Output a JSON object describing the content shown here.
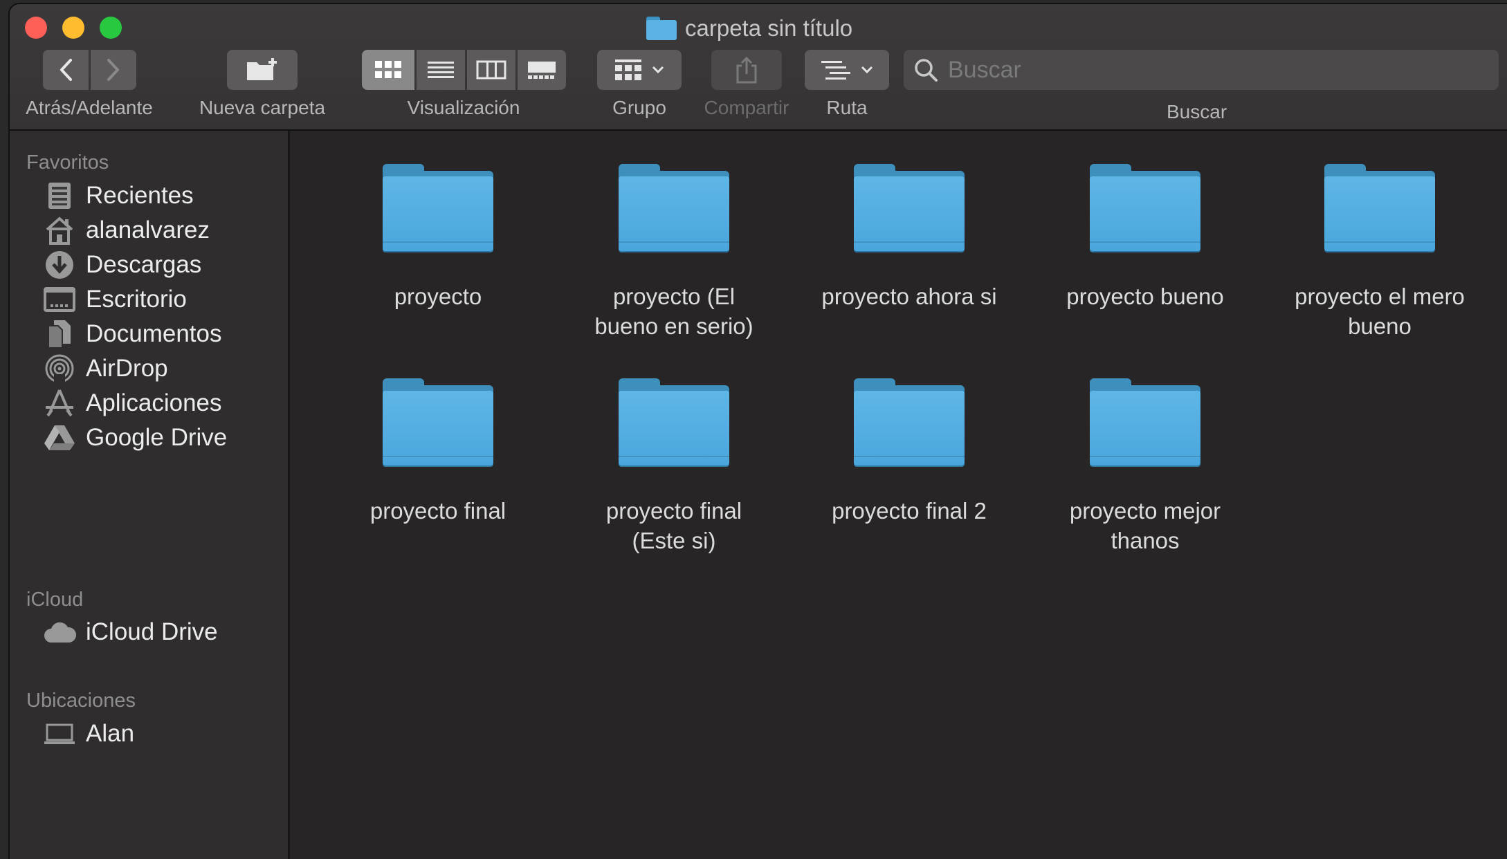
{
  "window": {
    "title": "carpeta sin título"
  },
  "toolbar": {
    "nav_label": "Atrás/Adelante",
    "new_folder_label": "Nueva carpeta",
    "view_label": "Visualización",
    "group_label": "Grupo",
    "share_label": "Compartir",
    "path_label": "Ruta",
    "search_label": "Buscar",
    "search_placeholder": "Buscar",
    "search_value": ""
  },
  "sidebar": {
    "favorites_title": "Favoritos",
    "favorites": [
      {
        "label": "Recientes",
        "icon": "recents-icon"
      },
      {
        "label": "alanalvarez",
        "icon": "home-icon"
      },
      {
        "label": "Descargas",
        "icon": "downloads-icon"
      },
      {
        "label": "Escritorio",
        "icon": "desktop-icon"
      },
      {
        "label": "Documentos",
        "icon": "documents-icon"
      },
      {
        "label": "AirDrop",
        "icon": "airdrop-icon"
      },
      {
        "label": "Aplicaciones",
        "icon": "applications-icon"
      },
      {
        "label": "Google Drive",
        "icon": "google-drive-icon"
      }
    ],
    "icloud_title": "iCloud",
    "icloud": [
      {
        "label": "iCloud Drive",
        "icon": "cloud-icon"
      }
    ],
    "locations_title": "Ubicaciones",
    "locations": [
      {
        "label": "Alan",
        "icon": "laptop-icon"
      }
    ]
  },
  "files": [
    {
      "name": "proyecto"
    },
    {
      "name": "proyecto (El bueno en serio)"
    },
    {
      "name": "proyecto ahora si"
    },
    {
      "name": "proyecto bueno"
    },
    {
      "name": "proyecto el mero bueno"
    },
    {
      "name": "proyecto final"
    },
    {
      "name": "proyecto final (Este si)"
    },
    {
      "name": "proyecto final 2"
    },
    {
      "name": "proyecto mejor thanos"
    }
  ],
  "colors": {
    "folder": "#5ab3e4",
    "window_bg": "#272525",
    "sidebar_bg": "#2f2d2d"
  }
}
